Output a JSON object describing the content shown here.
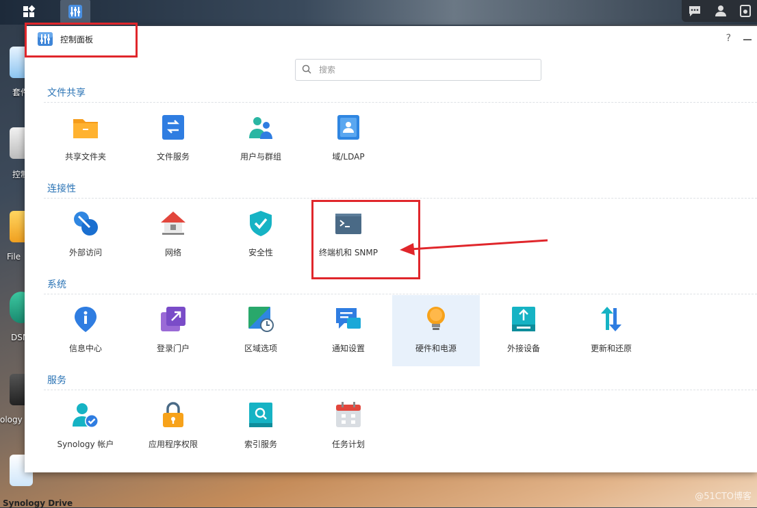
{
  "window": {
    "title": "控制面板",
    "help": "?"
  },
  "search": {
    "placeholder": "搜索"
  },
  "desktop": {
    "labels": [
      "套件",
      "控制",
      "File",
      "DSM",
      "ology",
      "Synology Drive"
    ]
  },
  "sections": [
    {
      "title": "文件共享",
      "items": [
        {
          "label": "共享文件夹",
          "icon": "shared-folder-icon"
        },
        {
          "label": "文件服务",
          "icon": "file-services-icon"
        },
        {
          "label": "用户与群组",
          "icon": "user-group-icon"
        },
        {
          "label": "域/LDAP",
          "icon": "domain-ldap-icon"
        }
      ]
    },
    {
      "title": "连接性",
      "items": [
        {
          "label": "外部访问",
          "icon": "external-access-icon"
        },
        {
          "label": "网络",
          "icon": "network-icon"
        },
        {
          "label": "安全性",
          "icon": "security-shield-icon"
        },
        {
          "label": "终端机和 SNMP",
          "icon": "terminal-icon"
        }
      ]
    },
    {
      "title": "系统",
      "items": [
        {
          "label": "信息中心",
          "icon": "info-center-icon"
        },
        {
          "label": "登录门户",
          "icon": "login-portal-icon"
        },
        {
          "label": "区域选项",
          "icon": "regional-options-icon"
        },
        {
          "label": "通知设置",
          "icon": "notification-icon"
        },
        {
          "label": "硬件和电源",
          "icon": "hardware-power-icon"
        },
        {
          "label": "外接设备",
          "icon": "external-devices-icon"
        },
        {
          "label": "更新和还原",
          "icon": "update-restore-icon"
        }
      ]
    },
    {
      "title": "服务",
      "items": [
        {
          "label": "Synology 帐户",
          "icon": "synology-account-icon"
        },
        {
          "label": "应用程序权限",
          "icon": "app-privileges-icon"
        },
        {
          "label": "索引服务",
          "icon": "indexing-service-icon"
        },
        {
          "label": "任务计划",
          "icon": "task-scheduler-icon"
        }
      ]
    }
  ],
  "watermark": "@51CTO博客",
  "colors": {
    "section_title": "#2a73b5",
    "annotation": "#e0262b",
    "selected_bg": "#e8f1fb"
  }
}
